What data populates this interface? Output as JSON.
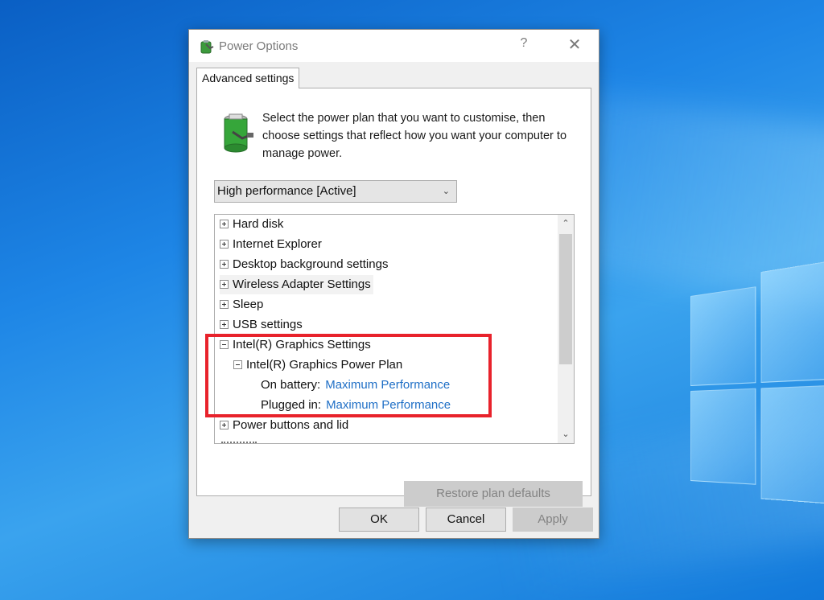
{
  "window": {
    "title": "Power Options",
    "help_label": "?",
    "close_label": "✕"
  },
  "tab": {
    "label": "Advanced settings"
  },
  "intro": {
    "text": "Select the power plan that you want to customise, then choose settings that reflect how you want your computer to manage power."
  },
  "plan_select": {
    "value": "High performance [Active]"
  },
  "tree": {
    "items": [
      {
        "label": "Hard disk",
        "state": "collapsed"
      },
      {
        "label": "Internet Explorer",
        "state": "collapsed"
      },
      {
        "label": "Desktop background settings",
        "state": "collapsed"
      },
      {
        "label": "Wireless Adapter Settings",
        "state": "collapsed"
      },
      {
        "label": "Sleep",
        "state": "collapsed"
      },
      {
        "label": "USB settings",
        "state": "collapsed"
      },
      {
        "label": "Intel(R) Graphics Settings",
        "state": "expanded"
      },
      {
        "label": "Intel(R) Graphics Power Plan",
        "state": "expanded"
      },
      {
        "label": "Power buttons and lid",
        "state": "collapsed"
      }
    ],
    "settings": [
      {
        "label": "On battery:",
        "value": "Maximum Performance"
      },
      {
        "label": "Plugged in:",
        "value": "Maximum Performance"
      }
    ]
  },
  "buttons": {
    "restore": "Restore plan defaults",
    "ok": "OK",
    "cancel": "Cancel",
    "apply": "Apply"
  },
  "colors": {
    "link": "#1f6fc6",
    "highlight": "#e8222b",
    "disabled_text": "#838383"
  }
}
